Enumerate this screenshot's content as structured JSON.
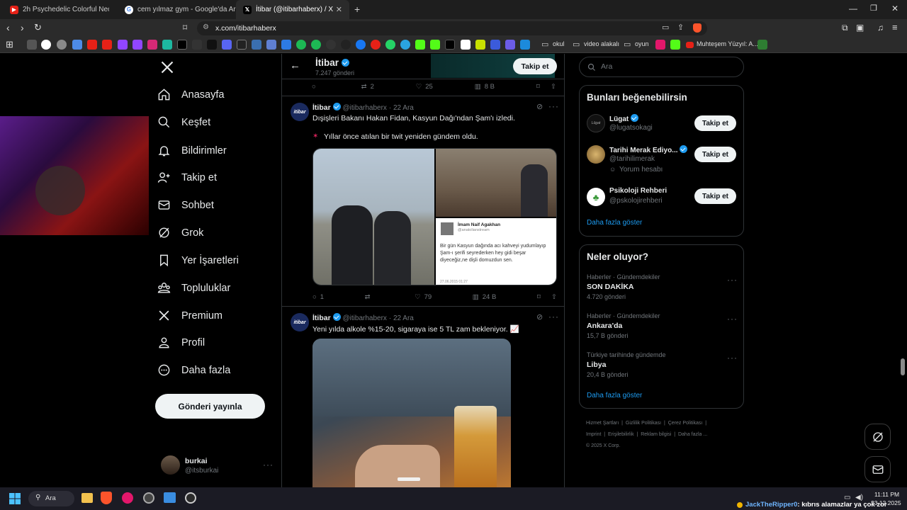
{
  "browser": {
    "tabs": [
      {
        "label": "2h Psychedelic Colorful Neon Backgr",
        "icon": "youtube-icon"
      },
      {
        "label": "cem yılmaz gym - Google'da Ara",
        "icon": "google-icon"
      },
      {
        "label": "İtibar (@itibarhaberx) / X",
        "icon": "x-logo-icon"
      }
    ],
    "url": "x.com/itibarhaberx",
    "bookmarks": {
      "okul": "okul",
      "video": "video alakalı",
      "oyun": "oyun",
      "muhtesem": "Muhteşem Yüzyıl: A..."
    }
  },
  "nav": {
    "items": [
      "Anasayfa",
      "Keşfet",
      "Bildirimler",
      "Takip et",
      "Sohbet",
      "Grok",
      "Yer İşaretleri",
      "Topluluklar",
      "Premium",
      "Profil",
      "Daha fazla"
    ],
    "post_button": "Gönderi yayınla",
    "account": {
      "name": "burkai",
      "handle": "@itsburkai"
    }
  },
  "profile_header": {
    "name": "İtibar",
    "posts": "7.247 gönderi",
    "follow": "Takip et"
  },
  "prev_tweet_actions": {
    "replies": "",
    "retweets": "2",
    "likes": "25",
    "views": "8 B"
  },
  "tweets": [
    {
      "avatar_text": "itibar",
      "name": "İtibar",
      "handle": "@itibarhaberx",
      "time": "· 22 Ara",
      "text": "Dışişleri Bakanı Hakan Fidan, Kasyun Dağı'ndan Şam'ı izledi.",
      "text2": "Yıllar önce atılan bir twit yeniden gündem oldu.",
      "embed": {
        "name": "İmam Naif Agakhan",
        "handle": "@anatolianstream",
        "text": "Bir gün Kasyun dağında acı kahveyi yudumlayıp Şam-ı şerifi seyrederken hey gidi beşar diyeceğiz,ne dişli domuzdun sen.",
        "date": "27.06.2015 01:27"
      },
      "actions": {
        "replies": "1",
        "retweets": "",
        "likes": "79",
        "views": "24 B"
      }
    },
    {
      "avatar_text": "itibar",
      "name": "İtibar",
      "handle": "@itibarhaberx",
      "time": "· 22 Ara",
      "text": "Yeni yılda alkole %15-20, sigaraya ise 5 TL zam bekleniyor. 📈"
    }
  ],
  "search": {
    "placeholder": "Ara"
  },
  "suggestions": {
    "title": "Bunları beğenebilirsin",
    "items": [
      {
        "name": "Lügat",
        "handle": "@lugatsokagi",
        "extra": "",
        "avatar_text": "Lûgat",
        "follow": "Takip et"
      },
      {
        "name": "Tarihi Merak Ediyo...",
        "handle": "@tarihilimerak",
        "extra": "Yorum hesabı",
        "avatar_text": "",
        "follow": "Takip et"
      },
      {
        "name": "Psikoloji Rehberi",
        "handle": "@pskolojirehberi",
        "extra": "",
        "avatar_text": "",
        "follow": "Takip et"
      }
    ],
    "more": "Daha fazla göster"
  },
  "trends": {
    "title": "Neler oluyor?",
    "items": [
      {
        "meta": "Haberler · Gündemdekiler",
        "name": "SON DAKİKA",
        "count": "4.720 gönderi"
      },
      {
        "meta": "Haberler · Gündemdekiler",
        "name": "Ankara'da",
        "count": "15,7 B gönderi"
      },
      {
        "meta": "Türkiye tarihinde gündemde",
        "name": "Libya",
        "count": "20,4 B gönderi"
      }
    ],
    "more": "Daha fazla göster"
  },
  "footer": {
    "links": [
      "Hizmet Şartları",
      "Gizlilik Politikası",
      "Çerez Politikası",
      "Imprint",
      "Erişilebilirlik",
      "Reklam bilgisi",
      "Daha fazla ..."
    ],
    "copyright": "© 2025 X Corp."
  },
  "taskbar": {
    "search": "Ara",
    "ticker_user": "JackTheRipper0",
    "ticker_text": ": kıbrıs alamazlar ya çok zor",
    "time": "11:11 PM",
    "date": "23.12.2025"
  },
  "colors": {
    "accent": "#1d9bf0",
    "background": "#000000",
    "border": "#2f3336",
    "muted": "#71767b"
  }
}
